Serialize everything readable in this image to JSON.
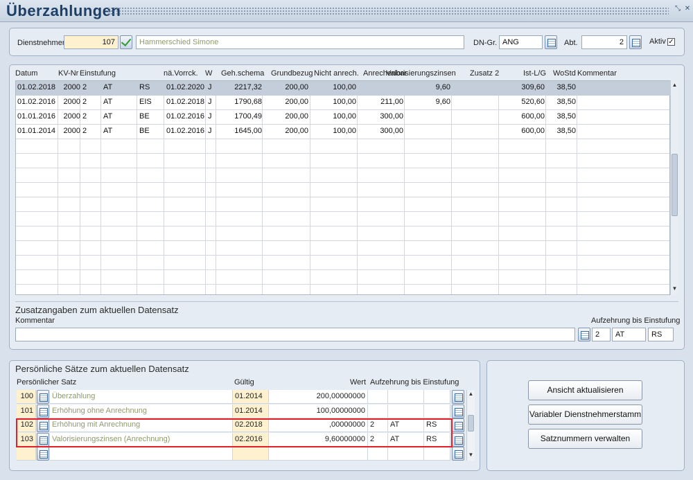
{
  "title": "Überzahlungen",
  "header": {
    "dn_label": "Dienstnehmer",
    "dn_nr": "107",
    "dn_name": "Hammerschied Simone",
    "dngr_label": "DN-Gr.",
    "dngr_value": "ANG",
    "abt_label": "Abt.",
    "abt_value": "2",
    "aktiv_label": "Aktiv",
    "aktiv_checked": "✓"
  },
  "main_grid": {
    "columns": [
      "Datum",
      "KV-Nr",
      "Einstufung",
      "nä.Vorrck.",
      "W",
      "Geh.schema",
      "Grundbezug",
      "Nicht anrech.",
      "Anrechenbar",
      "Valorisierungszinsen",
      "Zusatz 2",
      "Ist-L/G",
      "WoStd",
      "Kommentar"
    ],
    "rows": [
      {
        "datum": "01.02.2018",
        "kv": "2000",
        "e1": "2",
        "e2": "AT",
        "e3": "RS",
        "vorr": "01.02.2020",
        "w": "J",
        "schema": "2217,32",
        "grund": "200,00",
        "nicht": "100,00",
        "anrech": "",
        "valor": "9,60",
        "zus2": "",
        "ist": "309,60",
        "wostd": "38,50",
        "komm": ""
      },
      {
        "datum": "01.02.2016",
        "kv": "2000",
        "e1": "2",
        "e2": "AT",
        "e3": "EIS",
        "vorr": "01.02.2018",
        "w": "J",
        "schema": "1790,68",
        "grund": "200,00",
        "nicht": "100,00",
        "anrech": "211,00",
        "valor": "9,60",
        "zus2": "",
        "ist": "520,60",
        "wostd": "38,50",
        "komm": ""
      },
      {
        "datum": "01.01.2016",
        "kv": "2000",
        "e1": "2",
        "e2": "AT",
        "e3": "BE",
        "vorr": "01.02.2016",
        "w": "J",
        "schema": "1700,49",
        "grund": "200,00",
        "nicht": "100,00",
        "anrech": "300,00",
        "valor": "",
        "zus2": "",
        "ist": "600,00",
        "wostd": "38,50",
        "komm": ""
      },
      {
        "datum": "01.01.2014",
        "kv": "2000",
        "e1": "2",
        "e2": "AT",
        "e3": "BE",
        "vorr": "01.02.2016",
        "w": "J",
        "schema": "1645,00",
        "grund": "200,00",
        "nicht": "100,00",
        "anrech": "300,00",
        "valor": "",
        "zus2": "",
        "ist": "600,00",
        "wostd": "38,50",
        "komm": ""
      }
    ]
  },
  "zusatz": {
    "title": "Zusatzangaben zum aktuellen Datensatz",
    "kommentar_label": "Kommentar",
    "kommentar_value": "",
    "aufzehrung_label": "Aufzehrung bis Einstufung",
    "auf1": "2",
    "auf2": "AT",
    "auf3": "RS"
  },
  "personal": {
    "title": "Persönliche Sätze zum aktuellen Datensatz",
    "col_satz": "Persönlicher Satz",
    "col_gueltig": "Gültig",
    "col_wert": "Wert",
    "col_aufzehrung": "Aufzehrung bis Einstufung",
    "rows": [
      {
        "nr": "100",
        "name": "Überzahlung",
        "gueltig": "01.2014",
        "wert": "200,00000000",
        "a1": "",
        "a2": "",
        "a3": ""
      },
      {
        "nr": "101",
        "name": "Erhöhung ohne Anrechnung",
        "gueltig": "01.2014",
        "wert": "100,00000000",
        "a1": "",
        "a2": "",
        "a3": ""
      },
      {
        "nr": "102",
        "name": "Erhöhung mit Anrechnung",
        "gueltig": "02.2018",
        "wert": ",00000000",
        "a1": "2",
        "a2": "AT",
        "a3": "RS"
      },
      {
        "nr": "103",
        "name": "Valorisierungszinsen (Anrechnung)",
        "gueltig": "02.2016",
        "wert": "9,60000000",
        "a1": "2",
        "a2": "AT",
        "a3": "RS"
      },
      {
        "nr": "",
        "name": "",
        "gueltig": "",
        "wert": "",
        "a1": "",
        "a2": "",
        "a3": ""
      }
    ]
  },
  "buttons": {
    "refresh": "Ansicht aktualisieren",
    "variable": "Variabler Dienstnehmerstamm",
    "satznr": "Satznummern verwalten"
  }
}
